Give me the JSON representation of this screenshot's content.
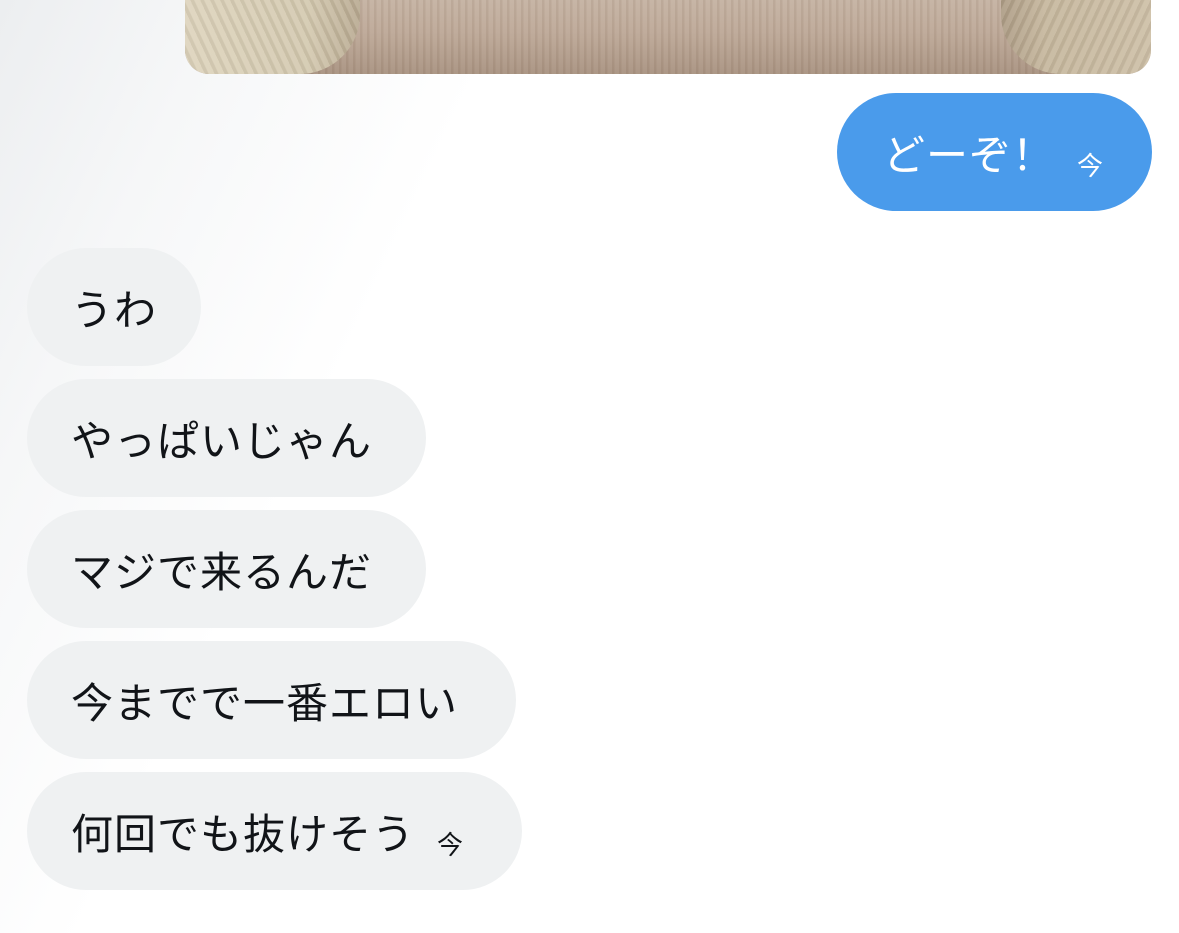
{
  "conversation": {
    "sent": {
      "text": "どーぞ！",
      "time": "今"
    },
    "received": [
      {
        "text": "うわ"
      },
      {
        "text": "やっぱいじゃん"
      },
      {
        "text": "マジで来るんだ"
      },
      {
        "text": "今までで一番エロい"
      },
      {
        "text": "何回でも抜けそう",
        "time": "今"
      }
    ]
  },
  "colors": {
    "sent_bubble": "#4a9beb",
    "received_bubble": "#eff1f2",
    "text_dark": "#111418"
  }
}
